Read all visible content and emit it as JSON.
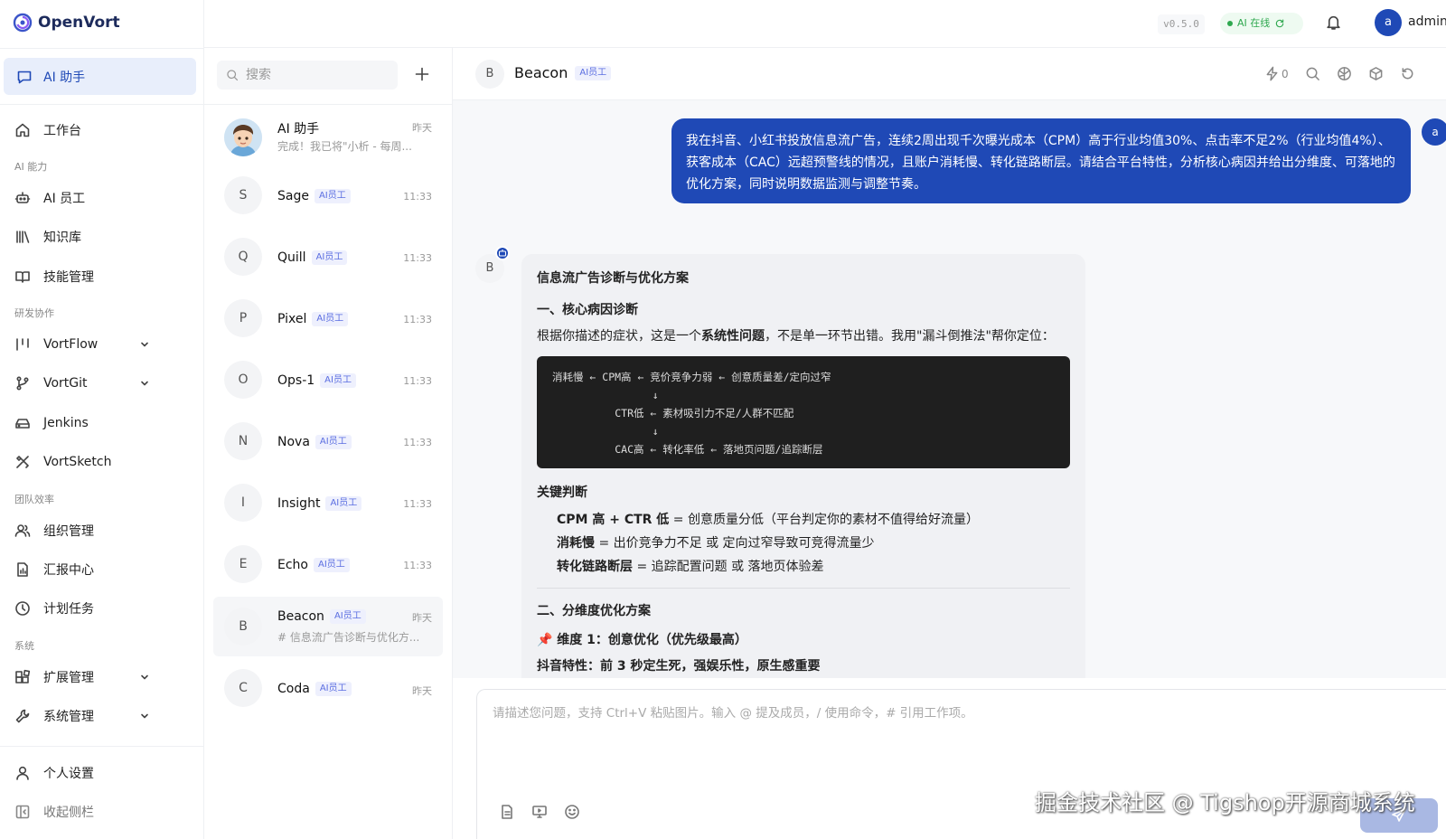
{
  "app": {
    "name": "OpenVort",
    "version": "v0.5.0",
    "ai_status": "AI 在线",
    "user_initial": "a",
    "user_name": "admin"
  },
  "sidebar": {
    "active": "AI 助手",
    "home": "工作台",
    "sections": [
      {
        "title": "AI 能力",
        "items": [
          "AI 员工",
          "知识库",
          "技能管理"
        ]
      },
      {
        "title": "研发协作",
        "items": [
          "VortFlow",
          "VortGit",
          "Jenkins",
          "VortSketch"
        ]
      },
      {
        "title": "团队效率",
        "items": [
          "组织管理",
          "汇报中心",
          "计划任务"
        ]
      },
      {
        "title": "系统",
        "items": [
          "扩展管理",
          "系统管理"
        ]
      }
    ],
    "bottom": [
      "个人设置",
      "收起侧栏"
    ]
  },
  "convlist": {
    "search_placeholder": "搜索",
    "tag": "AI员工",
    "items": [
      {
        "initial": "",
        "name": "AI 助手",
        "time": "昨天",
        "preview": "完成！我已将\"小析 - 每周...",
        "tagged": false
      },
      {
        "initial": "S",
        "name": "Sage",
        "time": "11:33"
      },
      {
        "initial": "Q",
        "name": "Quill",
        "time": "11:33"
      },
      {
        "initial": "P",
        "name": "Pixel",
        "time": "11:33"
      },
      {
        "initial": "O",
        "name": "Ops-1",
        "time": "11:33"
      },
      {
        "initial": "N",
        "name": "Nova",
        "time": "11:33"
      },
      {
        "initial": "I",
        "name": "Insight",
        "time": "11:33"
      },
      {
        "initial": "E",
        "name": "Echo",
        "time": "11:33"
      },
      {
        "initial": "B",
        "name": "Beacon",
        "time": "昨天",
        "preview": "# 信息流广告诊断与优化方..."
      },
      {
        "initial": "C",
        "name": "Coda",
        "time": "昨天"
      }
    ]
  },
  "chat": {
    "initial": "B",
    "name": "Beacon",
    "tag": "AI员工",
    "token_count": "0",
    "user_initial": "a",
    "user_message": "我在抖音、小红书投放信息流广告，连续2周出现千次曝光成本（CPM）高于行业均值30%、点击率不足2%（行业均值4%）、获客成本（CAC）远超预警线的情况，且账户消耗慢、转化链路断层。请结合平台特性，分析核心病因并给出分维度、可落地的优化方案，同时说明数据监测与调整节奏。",
    "reply": {
      "title": "信息流广告诊断与优化方案",
      "section1": "一、核心病因诊断",
      "intro_a": "根据你描述的症状，这是一个",
      "intro_bold": "系统性问题",
      "intro_b": "，不是单一环节出错。我用\"漏斗倒推法\"帮你定位：",
      "code": "消耗慢 ← CPM高 ← 竞价竞争力弱 ← 创意质量差/定向过窄\n                ↓\n          CTR低 ← 素材吸引力不足/人群不匹配\n                ↓\n          CAC高 ← 转化率低 ← 落地页问题/追踪断层",
      "judgement": "关键判断",
      "bullets": [
        {
          "bold": "CPM 高 + CTR 低",
          "text": " = 创意质量分低（平台判定你的素材不值得给好流量）"
        },
        {
          "bold": "消耗慢",
          "text": " = 出价竞争力不足 或 定向过窄导致可竞得流量少"
        },
        {
          "bold": "转化链路断层",
          "text": " = 追踪配置问题 或 落地页体验差"
        }
      ],
      "section2": "二、分维度优化方案",
      "dim1": "📌 维度 1：创意优化（优先级最高）",
      "cut_line": "抖音特性：前 3 秒定生死，强娱乐性，原生感重要"
    }
  },
  "input": {
    "placeholder": "请描述您问题，支持 Ctrl+V 粘贴图片。输入 @ 提及成员，/ 使用命令，# 引用工作项。"
  },
  "watermark": "掘金技术社区 @ Tigshop开源商城系统",
  "colors": {
    "primary": "#1f49b6",
    "tag": "#5b6ee1",
    "online": "#2fa84f"
  }
}
